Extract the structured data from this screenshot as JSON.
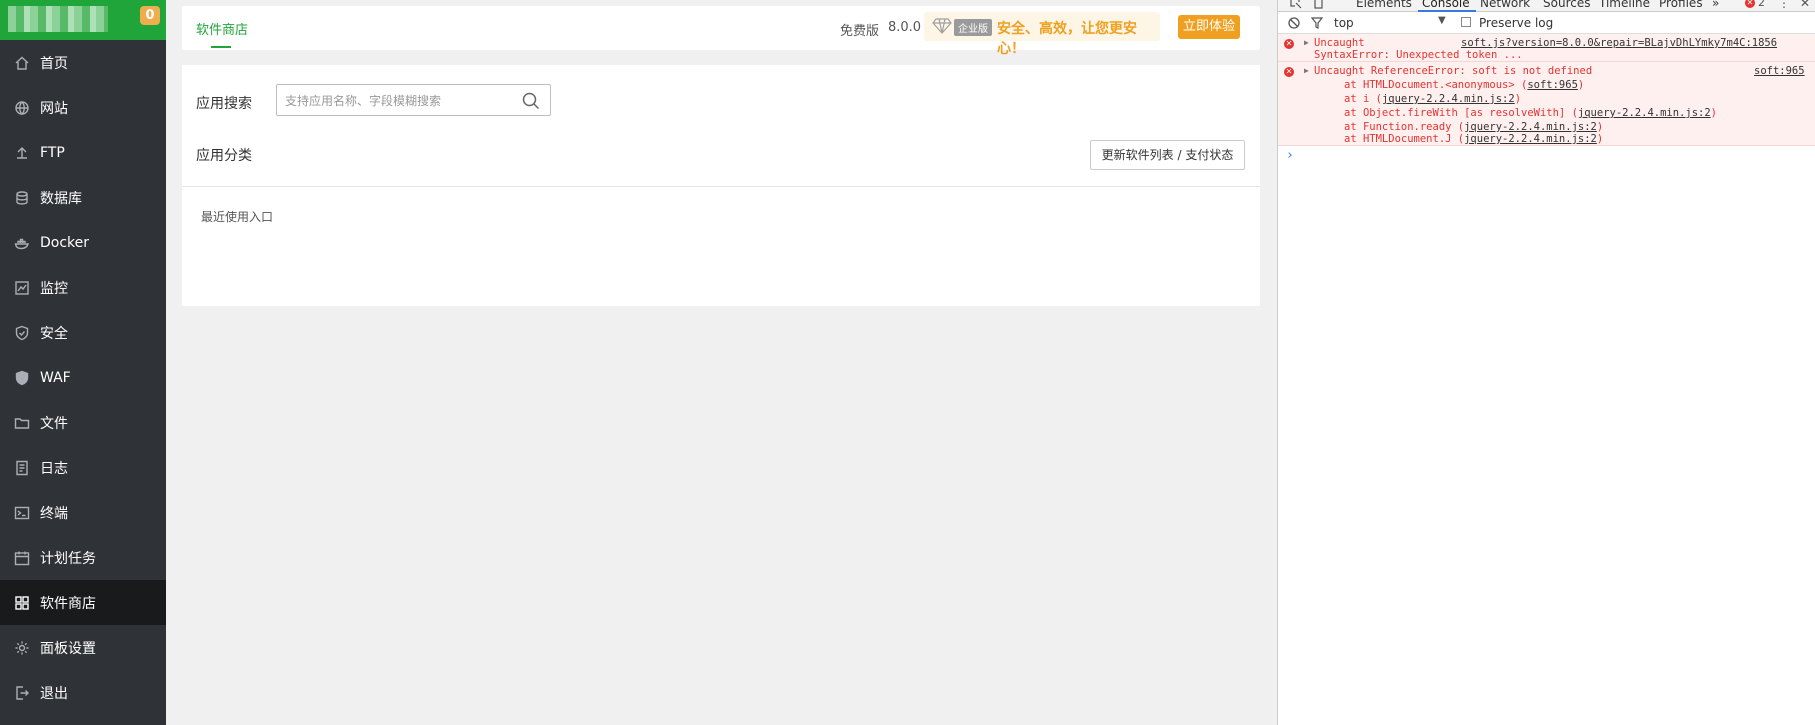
{
  "sidebar": {
    "badge": "0",
    "items": [
      {
        "label": "首页"
      },
      {
        "label": "网站"
      },
      {
        "label": "FTP"
      },
      {
        "label": "数据库"
      },
      {
        "label": "Docker"
      },
      {
        "label": "监控"
      },
      {
        "label": "安全"
      },
      {
        "label": "WAF"
      },
      {
        "label": "文件"
      },
      {
        "label": "日志"
      },
      {
        "label": "终端"
      },
      {
        "label": "计划任务"
      },
      {
        "label": "软件商店"
      },
      {
        "label": "面板设置"
      },
      {
        "label": "退出"
      }
    ],
    "active_index": 12
  },
  "topbar": {
    "tab": "软件商店",
    "edition": "免费版",
    "version": "8.0.0",
    "enterprise_tag": "企业版",
    "slogan": "安全、高效，让您更安心！",
    "try_button": "立即体验"
  },
  "panel": {
    "search_label": "应用搜索",
    "search_placeholder": "支持应用名称、字段模糊搜索",
    "category_label": "应用分类",
    "update_button": "更新软件列表 / 支付状态",
    "recent_label": "最近使用入口"
  },
  "devtools": {
    "tabs": [
      "Elements",
      "Console",
      "Network",
      "Sources",
      "Timeline",
      "Profiles"
    ],
    "more": "»",
    "error_count": "2",
    "context": "top",
    "preserve_log": "Preserve log",
    "errors": [
      {
        "message": "Uncaught",
        "detail": "SyntaxError: Unexpected token ...",
        "source": "soft.js?version=8.0.0&repair=BLajvDhLYmky7m4C:1856"
      },
      {
        "message": "Uncaught ReferenceError: soft is not defined",
        "source": "soft:965",
        "stack": [
          {
            "prefix": "at HTMLDocument.<anonymous> (",
            "link": "soft:965",
            "suffix": ")"
          },
          {
            "prefix": "at i (",
            "link": "jquery-2.2.4.min.js:2",
            "suffix": ")"
          },
          {
            "prefix": "at Object.fireWith [as resolveWith] (",
            "link": "jquery-2.2.4.min.js:2",
            "suffix": ")"
          },
          {
            "prefix": "at Function.ready (",
            "link": "jquery-2.2.4.min.js:2",
            "suffix": ")"
          },
          {
            "prefix": "at HTMLDocument.J (",
            "link": "jquery-2.2.4.min.js:2",
            "suffix": ")"
          }
        ]
      }
    ],
    "prompt": "›"
  }
}
